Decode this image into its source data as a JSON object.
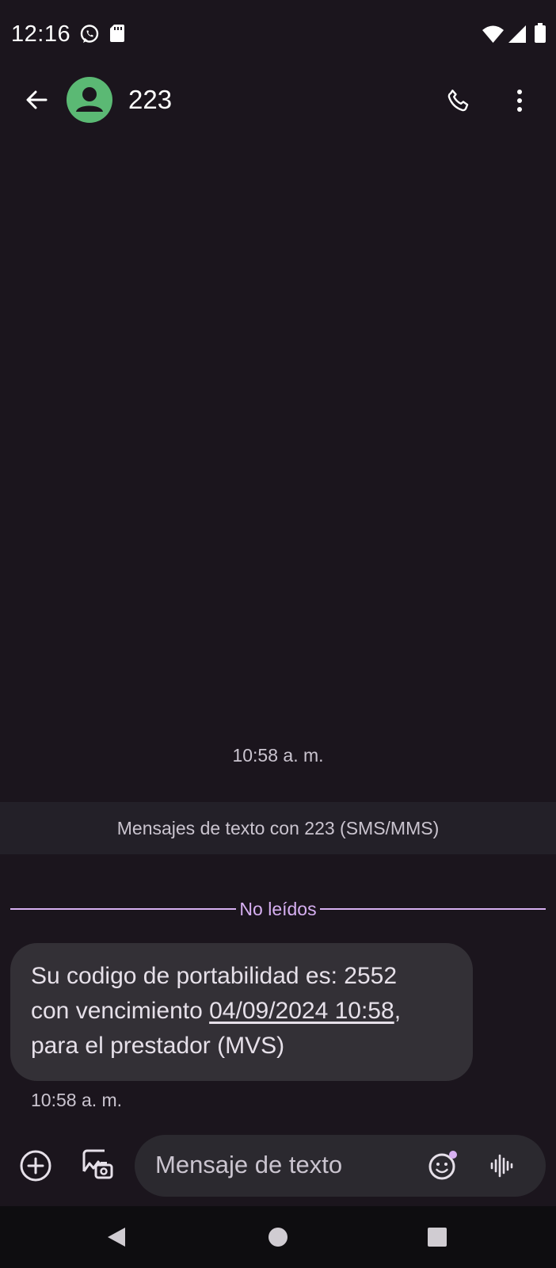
{
  "status_bar": {
    "time": "12:16",
    "icons": [
      "whatsapp-icon",
      "sd-card-icon",
      "wifi-icon",
      "signal-icon",
      "battery-icon"
    ]
  },
  "app_bar": {
    "contact_name": "223",
    "icons": [
      "back-arrow-icon",
      "person-icon",
      "phone-icon",
      "more-vert-icon"
    ]
  },
  "conversation": {
    "time_divider": "10:58 a. m.",
    "info_band": "Mensajes de texto con 223 (SMS/MMS)",
    "unread_label": "No leídos",
    "message": {
      "line1": "Su codigo de portabilidad es: 2552",
      "line2_prefix": "con vencimiento ",
      "line2_link": "04/09/2024 10:58",
      "line2_suffix": ",",
      "line3": "para el prestador (MVS)",
      "time": "10:58 a. m."
    }
  },
  "compose": {
    "placeholder": "Mensaje de texto",
    "icons": [
      "add-circle-icon",
      "gallery-icon",
      "emoji-icon",
      "voice-icon"
    ]
  },
  "nav_bar": {
    "icons": [
      "nav-back-icon",
      "nav-home-icon",
      "nav-recents-icon"
    ]
  },
  "colors": {
    "background": "#1b151d",
    "accent": "#d7b0f2",
    "avatar": "#5bb974",
    "bubble": "#333036",
    "info_band": "#232028",
    "compose_field": "#2b292f",
    "nav_bar": "#0e0d10"
  }
}
